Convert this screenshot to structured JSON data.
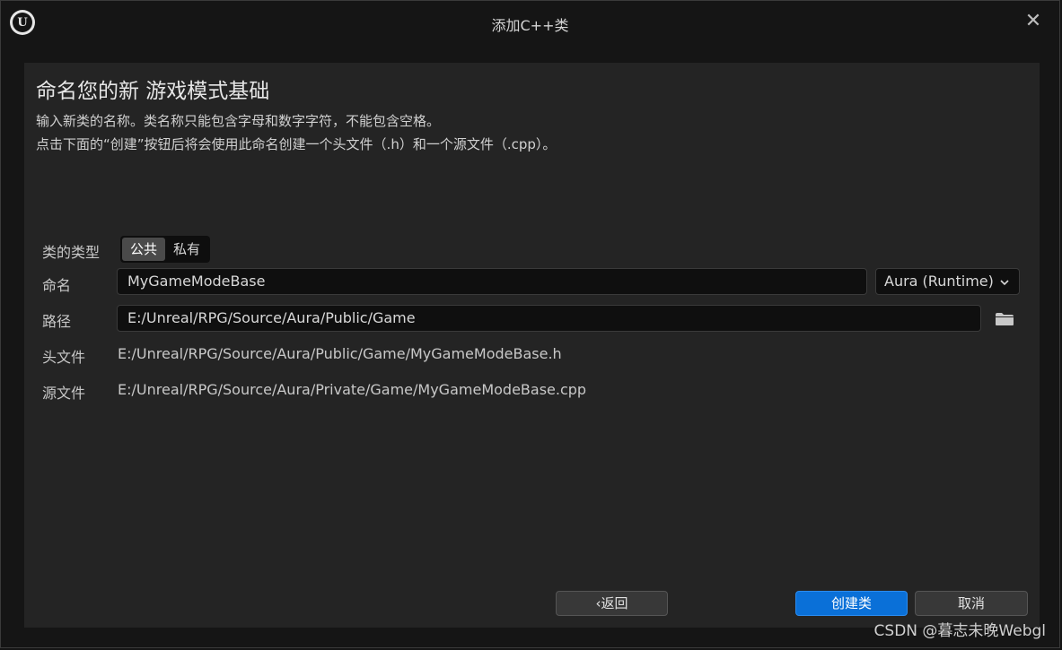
{
  "window": {
    "title": "添加C++类",
    "logo_letter": "U",
    "close_glyph": "✕"
  },
  "header": {
    "heading": "命名您的新 游戏模式基础",
    "desc_line1": "输入新类的名称。类名称只能包含字母和数字字符，不能包含空格。",
    "desc_line2": "点击下面的“创建”按钮后将会使用此命名创建一个头文件（.h）和一个源文件（.cpp）。"
  },
  "form": {
    "class_type_label": "类的类型",
    "class_type_options": [
      "公共",
      "私有"
    ],
    "class_type_selected": "公共",
    "name_label": "命名",
    "name_value": "MyGameModeBase",
    "module_value": "Aura (Runtime)",
    "path_label": "路径",
    "path_value": "E:/Unreal/RPG/Source/Aura/Public/Game",
    "header_label": "头文件",
    "header_value": "E:/Unreal/RPG/Source/Aura/Public/Game/MyGameModeBase.h",
    "source_label": "源文件",
    "source_value": "E:/Unreal/RPG/Source/Aura/Private/Game/MyGameModeBase.cpp"
  },
  "footer": {
    "back_label": "‹返回",
    "create_label": "创建类",
    "cancel_label": "取消"
  },
  "watermark": "CSDN @暮志未晚Webgl",
  "colors": {
    "background": "#151515",
    "panel": "#242424",
    "primary_button": "#0a70d8"
  },
  "icons": {
    "folder": "folder-icon",
    "chevron": "chevron-down-icon",
    "close": "close-icon"
  }
}
